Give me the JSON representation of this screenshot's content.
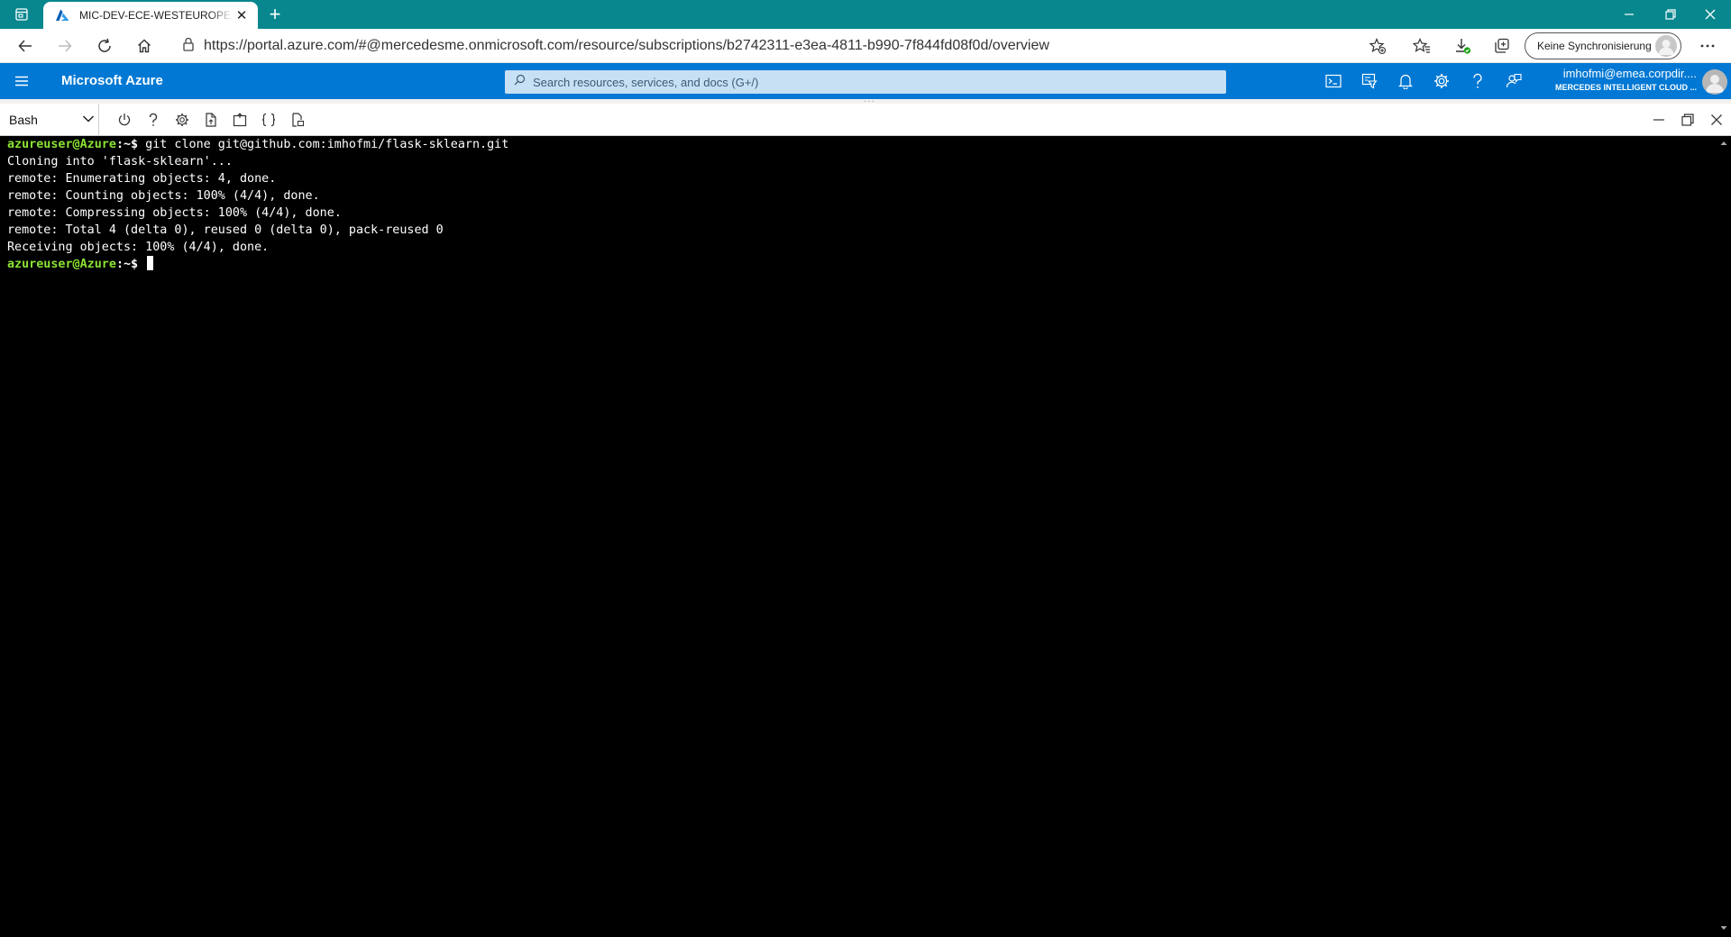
{
  "browser": {
    "tab_title": "MIC-DEV-ECE-WESTEUROPE-DD",
    "url": "https://portal.azure.com/#@mercedesme.onmicrosoft.com/resource/subscriptions/b2742311-e3ea-4811-b990-7f844fd08f0d/overview",
    "sync_label": "Keine Synchronisierung",
    "accent_color": "#08878e"
  },
  "portal": {
    "brand": "Microsoft Azure",
    "search_placeholder": "Search resources, services, and docs (G+/)",
    "account_name": "imhofmi@emea.corpdir....",
    "account_directory": "MERCEDES INTELLIGENT CLOUD ...",
    "header_color": "#0078d4"
  },
  "shell": {
    "selected_shell": "Bash"
  },
  "terminal": {
    "prompt_user": "azureuser@Azure",
    "prompt_suffix": ":~$",
    "lines": [
      {
        "type": "cmd",
        "text": " git clone git@github.com:imhofmi/flask-sklearn.git"
      },
      {
        "type": "out",
        "text": "Cloning into 'flask-sklearn'..."
      },
      {
        "type": "out",
        "text": "remote: Enumerating objects: 4, done."
      },
      {
        "type": "out",
        "text": "remote: Counting objects: 100% (4/4), done."
      },
      {
        "type": "out",
        "text": "remote: Compressing objects: 100% (4/4), done."
      },
      {
        "type": "out",
        "text": "remote: Total 4 (delta 0), reused 0 (delta 0), pack-reused 0"
      },
      {
        "type": "out",
        "text": "Receiving objects: 100% (4/4), done."
      },
      {
        "type": "cmd",
        "text": " "
      }
    ]
  }
}
